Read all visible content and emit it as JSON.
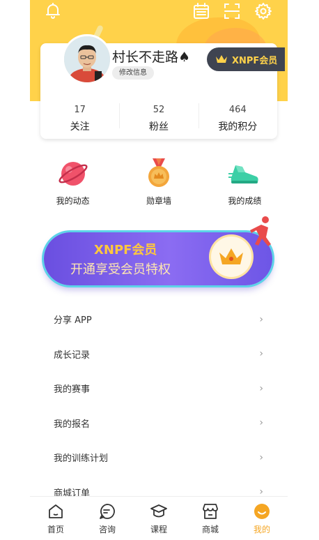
{
  "profile": {
    "username": "村长不走路",
    "suit_icon": "spade-icon",
    "edit_label": "修改信息",
    "vip_label": "XNPF会员"
  },
  "stats": [
    {
      "value": "17",
      "label": "关注"
    },
    {
      "value": "52",
      "label": "粉丝"
    },
    {
      "value": "464",
      "label": "我的积分"
    }
  ],
  "quick_links": [
    {
      "label": "我的动态",
      "icon": "planet-icon"
    },
    {
      "label": "勋章墙",
      "icon": "medal-icon"
    },
    {
      "label": "我的成绩",
      "icon": "sneaker-icon"
    }
  ],
  "banner": {
    "title": "XNPF会员",
    "subtitle": "开通享受会员特权"
  },
  "menu": [
    {
      "label": "分享 APP"
    },
    {
      "label": "成长记录"
    },
    {
      "label": "我的赛事"
    },
    {
      "label": "我的报名"
    },
    {
      "label": "我的训练计划"
    },
    {
      "label": "商城订单"
    }
  ],
  "tabs": [
    {
      "label": "首页",
      "icon": "home-icon"
    },
    {
      "label": "咨询",
      "icon": "chat-icon"
    },
    {
      "label": "课程",
      "icon": "graduation-cap-icon"
    },
    {
      "label": "商城",
      "icon": "store-icon"
    },
    {
      "label": "我的",
      "icon": "profile-icon",
      "active": true
    }
  ],
  "colors": {
    "header_yellow": "#FFD24A",
    "accent_orange": "#F5A623",
    "vip_dark": "#3F4451",
    "banner_purple": "#7A5CEA"
  }
}
